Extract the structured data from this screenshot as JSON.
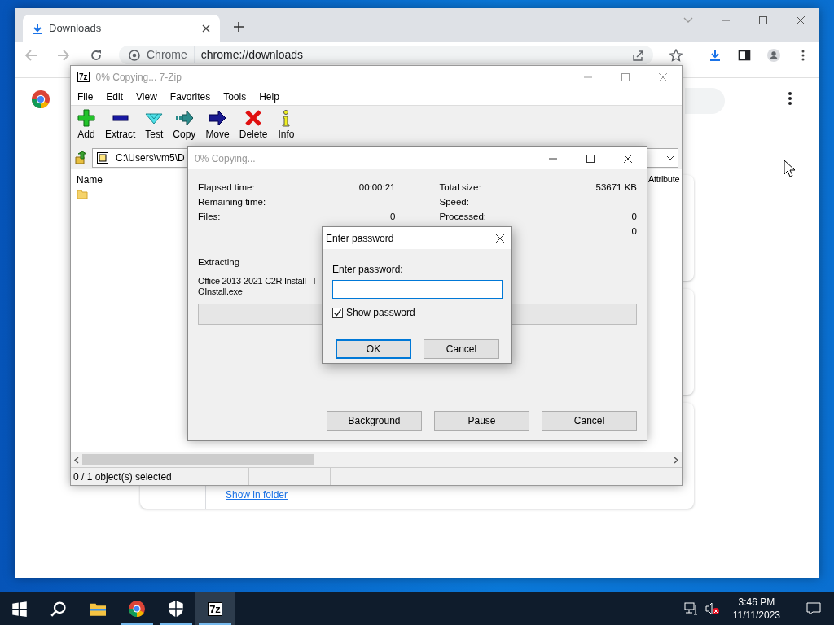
{
  "browser": {
    "tab": {
      "title": "Downloads"
    },
    "omnibox": {
      "chip": "Chrome",
      "url": "chrome://downloads"
    },
    "download_link": "Show in folder"
  },
  "archive_manager": {
    "icon_text": "7z",
    "title": "0% Copying... 7-Zip",
    "menu": [
      "File",
      "Edit",
      "View",
      "Favorites",
      "Tools",
      "Help"
    ],
    "toolbar": [
      {
        "kind": "add",
        "label": "Add"
      },
      {
        "kind": "extract",
        "label": "Extract"
      },
      {
        "kind": "test",
        "label": "Test"
      },
      {
        "kind": "copy",
        "label": "Copy"
      },
      {
        "kind": "move",
        "label": "Move"
      },
      {
        "kind": "delete",
        "label": "Delete"
      },
      {
        "kind": "info",
        "label": "Info"
      }
    ],
    "path": "C:\\Users\\vm5\\D",
    "columns": [
      "Name",
      "Attribute"
    ],
    "status": "0 / 1 object(s) selected"
  },
  "progress_dialog": {
    "title": "0% Copying...",
    "stats_left": [
      {
        "label": "Elapsed time:",
        "value": "00:00:21"
      },
      {
        "label": "Remaining time:"
      },
      {
        "label": "Files:",
        "value": "0"
      }
    ],
    "stats_right": [
      {
        "label": "Total size:",
        "value": "53671 KB"
      },
      {
        "label": "Speed:"
      },
      {
        "label": "Processed:",
        "value": "0"
      },
      {
        "value": "0"
      }
    ],
    "operation": "Extracting",
    "file_lines": [
      "Office 2013-2021 C2R Install - I",
      "OInstall.exe"
    ],
    "progress": {
      "level": 0
    },
    "buttons": [
      "Background",
      "Pause",
      "Cancel"
    ]
  },
  "password_dialog": {
    "title": "Enter password",
    "prompt": "Enter password:",
    "show_password": {
      "label": "Show password",
      "checked": true
    },
    "buttons": [
      {
        "label": "OK",
        "default": true
      },
      {
        "label": "Cancel",
        "default": false
      }
    ]
  },
  "taskbar": {
    "apps": [
      {
        "kind": "start",
        "running": false,
        "selected": false
      },
      {
        "kind": "search",
        "running": false,
        "selected": false
      },
      {
        "kind": "explorer",
        "running": false,
        "selected": false
      },
      {
        "kind": "chrome",
        "running": true,
        "selected": false
      },
      {
        "kind": "security",
        "running": true,
        "selected": false
      },
      {
        "kind": "archiver",
        "running": true,
        "selected": true,
        "icon_text": "7z"
      }
    ],
    "time": "3:46 PM",
    "date": "11/11/2023"
  }
}
